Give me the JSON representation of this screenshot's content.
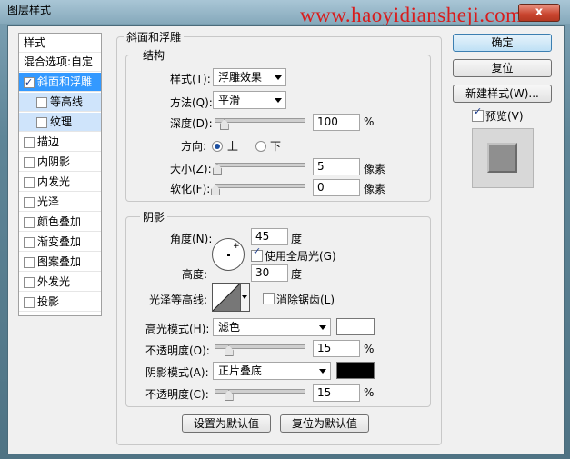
{
  "window": {
    "title": "图层样式",
    "watermark": "www.haoyidiansheji.com",
    "close_label": "x"
  },
  "style_list": {
    "header": "样式",
    "items": [
      {
        "label": "混合选项:自定",
        "checkbox": false,
        "checked": false,
        "state": "normal"
      },
      {
        "label": "斜面和浮雕",
        "checkbox": true,
        "checked": true,
        "state": "selected"
      },
      {
        "label": "等高线",
        "checkbox": true,
        "checked": false,
        "state": "sub"
      },
      {
        "label": "纹理",
        "checkbox": true,
        "checked": false,
        "state": "sub"
      },
      {
        "label": "描边",
        "checkbox": true,
        "checked": false,
        "state": "normal"
      },
      {
        "label": "内阴影",
        "checkbox": true,
        "checked": false,
        "state": "normal"
      },
      {
        "label": "内发光",
        "checkbox": true,
        "checked": false,
        "state": "normal"
      },
      {
        "label": "光泽",
        "checkbox": true,
        "checked": false,
        "state": "normal"
      },
      {
        "label": "颜色叠加",
        "checkbox": true,
        "checked": false,
        "state": "normal"
      },
      {
        "label": "渐变叠加",
        "checkbox": true,
        "checked": false,
        "state": "normal"
      },
      {
        "label": "图案叠加",
        "checkbox": true,
        "checked": false,
        "state": "normal"
      },
      {
        "label": "外发光",
        "checkbox": true,
        "checked": false,
        "state": "normal"
      },
      {
        "label": "投影",
        "checkbox": true,
        "checked": false,
        "state": "normal"
      }
    ]
  },
  "bevel": {
    "title": "斜面和浮雕",
    "structure": {
      "title": "结构",
      "style_label": "样式(T):",
      "style_value": "浮雕效果",
      "technique_label": "方法(Q):",
      "technique_value": "平滑",
      "depth_label": "深度(D):",
      "depth_value": "100",
      "depth_unit": "%",
      "depth_fraction": 0.1,
      "direction_label": "方向:",
      "direction_up": "上",
      "direction_down": "下",
      "direction_selected": "上",
      "size_label": "大小(Z):",
      "size_value": "5",
      "size_unit": "像素",
      "size_fraction": 0.02,
      "soften_label": "软化(F):",
      "soften_value": "0",
      "soften_unit": "像素",
      "soften_fraction": 0.0
    },
    "shading": {
      "title": "阴影",
      "angle_label": "角度(N):",
      "angle_value": "45",
      "angle_unit": "度",
      "global_light_label": "使用全局光(G)",
      "global_light_checked": true,
      "altitude_label": "高度:",
      "altitude_value": "30",
      "altitude_unit": "度",
      "gloss_contour_label": "光泽等高线:",
      "anti_aliased_label": "消除锯齿(L)",
      "anti_aliased_checked": false,
      "highlight_mode_label": "高光模式(H):",
      "highlight_mode_value": "滤色",
      "highlight_color": "#ffffff",
      "highlight_opacity_label": "不透明度(O):",
      "highlight_opacity_value": "15",
      "highlight_opacity_unit": "%",
      "highlight_opacity_fraction": 0.15,
      "shadow_mode_label": "阴影模式(A):",
      "shadow_mode_value": "正片叠底",
      "shadow_color": "#000000",
      "shadow_opacity_label": "不透明度(C):",
      "shadow_opacity_value": "15",
      "shadow_opacity_unit": "%",
      "shadow_opacity_fraction": 0.15
    },
    "make_default_label": "设置为默认值",
    "reset_default_label": "复位为默认值"
  },
  "actions": {
    "ok_label": "确定",
    "reset_label": "复位",
    "new_style_label": "新建样式(W)...",
    "preview_label": "预览(V)",
    "preview_checked": true
  }
}
